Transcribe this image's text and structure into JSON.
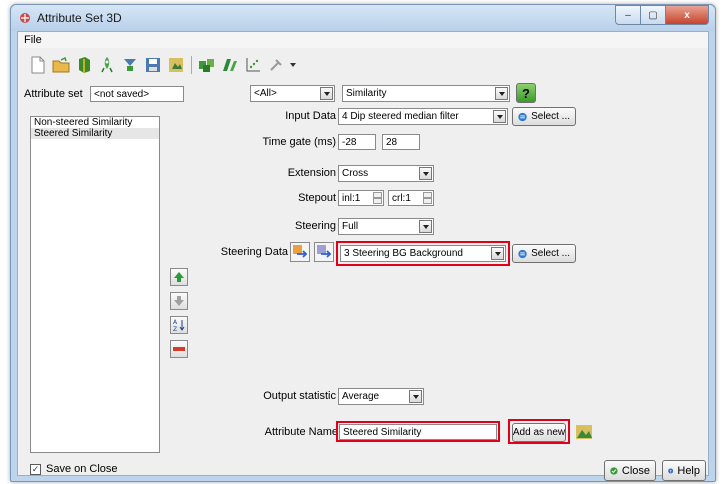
{
  "window": {
    "title": "Attribute Set 3D",
    "min": "–",
    "max": "▢",
    "close": "x"
  },
  "menu": {
    "file": "File"
  },
  "toolbar": {
    "icons": [
      "new-file-icon",
      "open-folder-icon",
      "cube-icon",
      "rocket-icon",
      "import-icon",
      "save-icon",
      "save-as-icon",
      "cube-pair-icon",
      "evaluate-icon",
      "crossplot-icon",
      "tools-icon"
    ]
  },
  "attrset": {
    "label": "Attribute set",
    "value": "<not saved>"
  },
  "filter": {
    "value": "<All>"
  },
  "attr_type": {
    "value": "Similarity"
  },
  "help": {
    "label": "?"
  },
  "attributes": {
    "items": [
      "Non-steered Similarity",
      "Steered Similarity"
    ],
    "selected": 1
  },
  "input_data": {
    "label": "Input Data",
    "value": "4 Dip steered median filter",
    "select": "Select ..."
  },
  "time_gate": {
    "label": "Time gate (ms)",
    "start": "-28",
    "stop": "28"
  },
  "extension": {
    "label": "Extension",
    "value": "Cross"
  },
  "stepout": {
    "label": "Stepout",
    "inl": "inl:1",
    "crl": "crl:1"
  },
  "steering": {
    "label": "Steering",
    "value": "Full"
  },
  "steering_data": {
    "label": "Steering Data",
    "value": "3 Steering BG Background",
    "select": "Select ..."
  },
  "output_statistic": {
    "label": "Output statistic",
    "value": "Average"
  },
  "attribute_name": {
    "label": "Attribute Name",
    "value": "Steered Similarity",
    "add": "Add as new"
  },
  "footer": {
    "save_on_close": "Save on Close",
    "checked": true,
    "close": "Close",
    "help": "Help"
  },
  "colors": {
    "highlight": "#e0001a",
    "titlebar": "#bcd4ec"
  }
}
